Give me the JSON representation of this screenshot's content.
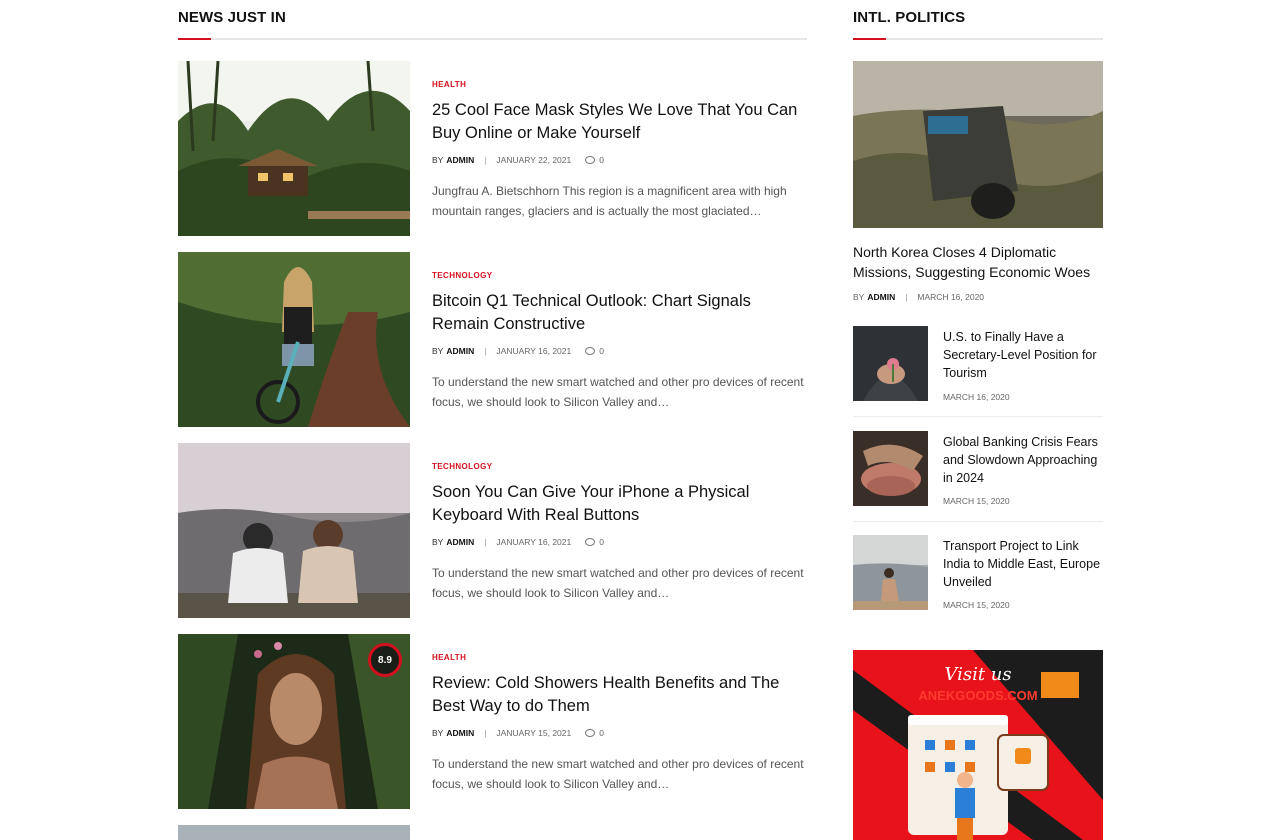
{
  "main_section": {
    "title": "NEWS JUST IN",
    "posts": [
      {
        "category": "HEALTH",
        "title": "25 Cool Face Mask Styles We Love That You Can Buy Online or Make Yourself",
        "by": "BY",
        "author": "ADMIN",
        "date": "JANUARY 22, 2021",
        "comments": "0",
        "excerpt": "Jungfrau A. Bietschhorn This region is a magnificent area with high mountain ranges, glaciers and is actually the most glaciated…"
      },
      {
        "category": "TECHNOLOGY",
        "title": "Bitcoin Q1 Technical Outlook: Chart Signals Remain Constructive",
        "by": "BY",
        "author": "ADMIN",
        "date": "JANUARY 16, 2021",
        "comments": "0",
        "excerpt": "To understand the new smart watched and other pro devices of recent focus, we should look to Silicon Valley and…"
      },
      {
        "category": "TECHNOLOGY",
        "title": "Soon You Can Give Your iPhone a Physical Keyboard With Real Buttons",
        "by": "BY",
        "author": "ADMIN",
        "date": "JANUARY 16, 2021",
        "comments": "0",
        "excerpt": "To understand the new smart watched and other pro devices of recent focus, we should look to Silicon Valley and…"
      },
      {
        "category": "HEALTH",
        "title": "Review: Cold Showers Health Benefits and The Best Way to do Them",
        "by": "BY",
        "author": "ADMIN",
        "date": "JANUARY 15, 2021",
        "comments": "0",
        "score": "8.9",
        "excerpt": "To understand the new smart watched and other pro devices of recent focus, we should look to Silicon Valley and…"
      }
    ]
  },
  "sidebar": {
    "title": "INTL. POLITICS",
    "feature": {
      "title": "North Korea Closes 4 Diplomatic Missions, Suggesting Economic Woes",
      "by": "BY",
      "author": "ADMIN",
      "date": "MARCH 16, 2020"
    },
    "items": [
      {
        "title": "U.S. to Finally Have a Secretary-Level Position for Tourism",
        "date": "MARCH 16, 2020"
      },
      {
        "title": "Global Banking Crisis Fears and Slowdown Approaching in 2024",
        "date": "MARCH 15, 2020"
      },
      {
        "title": "Transport Project to Link India to Middle East, Europe Unveiled",
        "date": "MARCH 15, 2020"
      }
    ],
    "ad": {
      "visit": "Visit us",
      "site": "ANEKGOODS.COM"
    }
  },
  "colors": {
    "accent": "#d4101e",
    "text": "#111111",
    "muted": "#666666"
  }
}
